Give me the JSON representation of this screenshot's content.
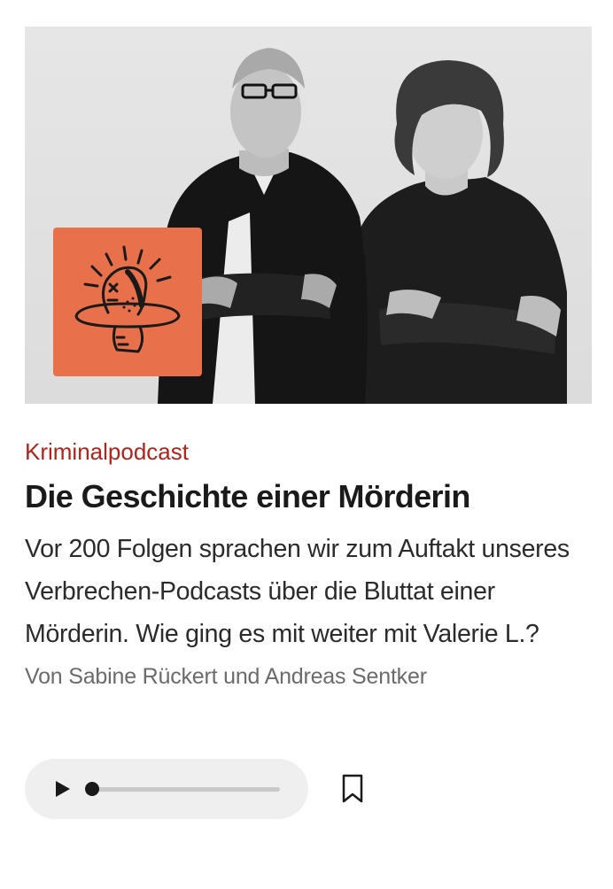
{
  "teaser": {
    "kicker": "Kriminalpodcast",
    "headline": "Die Geschichte einer Mörderin",
    "summary": "Vor 200 Folgen sprachen wir zum Auftakt unseres Verbrechen-Podcasts über die Bluttat einer Mörderin. Wie ging es mit weiter mit Valerie L.?",
    "byline": "Von Sabine Rückert und Andreas Sentker"
  },
  "hero": {
    "image_alt": "Schwarz-Weiß-Foto der Podcast-Hosts mit verschränkten Armen",
    "badge_icon": "head-on-plate-icon",
    "badge_color": "#e8704a"
  },
  "player": {
    "play_icon": "play-icon",
    "progress": 0.0,
    "bookmark_icon": "bookmark-icon"
  },
  "colors": {
    "kicker": "#b3221b",
    "text": "#1a1a1a",
    "byline": "#6b6b6b",
    "player_bg": "#efefef"
  }
}
